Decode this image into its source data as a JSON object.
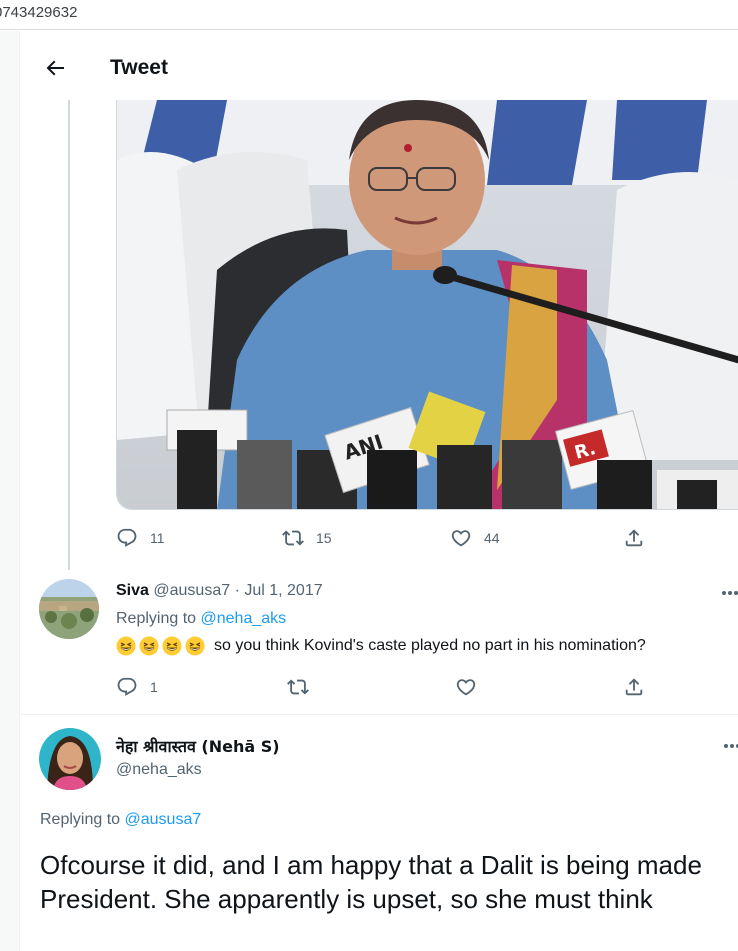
{
  "browser": {
    "url_fragment": "0743429632"
  },
  "header": {
    "title": "Tweet"
  },
  "original_tweet": {
    "stats": {
      "replies": "11",
      "retweets": "15",
      "likes": "44"
    },
    "media_text": {
      "mic_logo_1": "ANI",
      "mic_logo_2": "R."
    }
  },
  "reply_tweet": {
    "author_name": "Siva",
    "author_handle": "@aususa7",
    "date": "· Jul 1, 2017",
    "replying_prefix": "Replying to",
    "replying_mention": "@neha_aks",
    "text": "so you think Kovind's caste played no part in his nomination?",
    "emoji_count": 4,
    "stats": {
      "replies": "1"
    }
  },
  "main_tweet": {
    "author_name": "नेहा श्रीवास्तव (Nehā S)",
    "author_handle": "@neha_aks",
    "replying_prefix": "Replying to",
    "replying_mention": "@aususa7",
    "text": "Ofcourse it did, and I am happy that a Dalit is being made President. She apparently is upset, so she must think"
  },
  "colors": {
    "accent": "#1d9bf0",
    "secondary_text": "#536471",
    "primary_text": "#0f1419"
  }
}
